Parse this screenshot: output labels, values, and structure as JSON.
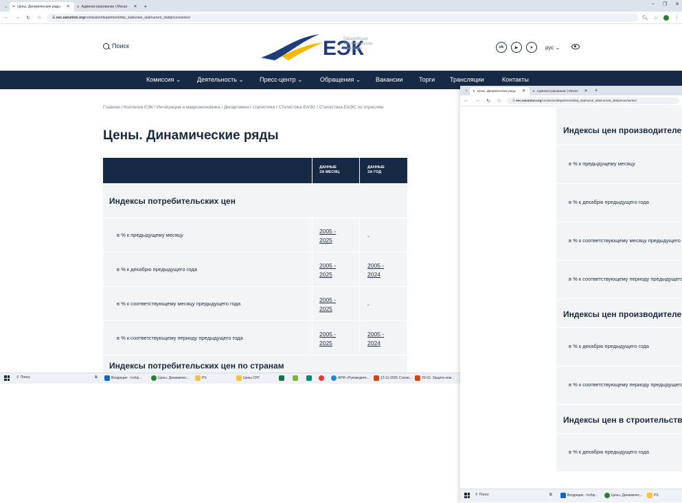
{
  "browser1": {
    "tabs": [
      {
        "label": "Цены. Динамические ряды"
      },
      {
        "label": "Администрирование | Мекал"
      }
    ],
    "new_tab": "+",
    "url_host": "eec.eaeunion.org",
    "url_path": "/comission/department/dep_stat/union_stat/current_stat/prices/series/"
  },
  "site": {
    "search_label": "Поиск",
    "logo_abbr": "ЕЭК",
    "logo_lines": [
      "Евразийская",
      "экономическая",
      "комиссия"
    ],
    "social": [
      "vk-icon",
      "youtube-icon",
      "telegram-icon"
    ],
    "lang_label": "рус",
    "nav": [
      {
        "label": "Комиссия ⌄"
      },
      {
        "label": "Деятельность ⌄"
      },
      {
        "label": "Пресс-центр ⌄"
      },
      {
        "label": "Обращения ⌄"
      },
      {
        "label": "Вакансии"
      },
      {
        "label": "Торги"
      },
      {
        "label": "Трансляции"
      },
      {
        "label": "Контакты"
      }
    ],
    "breadcrumb": "Главная / Коллегия ЕЭК / Интеграция и макроэкономика / Департамент статистики / Статистика ЕАЭС / Статистика ЕАЭС по отраслям",
    "page_title": "Цены. Динамические ряды",
    "table": {
      "col_month": "ДАННЫЕ ЗА МЕСЯЦ",
      "col_month_l1": "ДАННЫЕ",
      "col_month_l2": "ЗА МЕСЯЦ",
      "col_year_l1": "ДАННЫЕ",
      "col_year_l2": "ЗА ГОД",
      "section1": "Индексы потребительских цен",
      "rows": [
        {
          "label": "в % к предыдущему месяцу",
          "month_a": "2005 -",
          "month_b": "2025",
          "year_a": "-",
          "year_b": ""
        },
        {
          "label": "в % к декабрю предыдущего года",
          "month_a": "2005 -",
          "month_b": "2025",
          "year_a": "2005 -",
          "year_b": "2024"
        },
        {
          "label": "в % к соответствующему месяцу предыдущего года",
          "month_a": "2005 -",
          "month_b": "2025",
          "year_a": "-",
          "year_b": ""
        },
        {
          "label": "в % к соответствующему периоду предыдущего года",
          "month_a": "2005 -",
          "month_b": "2025",
          "year_a": "2005 -",
          "year_b": "2024"
        }
      ],
      "section2": "Индексы потребительских цен по странам"
    }
  },
  "taskbar1": {
    "search": "Поиск",
    "items": [
      "Входящие - Irzhip...",
      "Цены. Динамичес...",
      "PS",
      "Цены СНГ",
      "АРМ «Руководите...",
      "12-11-2025 Статис...",
      "20-02. Защита ком..."
    ]
  },
  "browser2": {
    "tabs": [
      {
        "label": "Цены. Динамические ряды"
      },
      {
        "label": "Администрирование | Мекал"
      }
    ],
    "url_host": "eec.eaeunion.org",
    "url_path": "/comission/department/dep_stat/union_stat/current_stat/prices/series/",
    "blocks": [
      {
        "kind": "section",
        "text": "Индексы цен производителей"
      },
      {
        "kind": "row",
        "text": "в % к предыдущему месяцу"
      },
      {
        "kind": "row",
        "text": "в % к декабрю предыдущего года"
      },
      {
        "kind": "row",
        "text": "в % к соответствующему месяцу предыдущего года"
      },
      {
        "kind": "row",
        "text": "в % к соответствующему периоду предыдущего года"
      },
      {
        "kind": "section",
        "text": "Индексы цен производителей"
      },
      {
        "kind": "row",
        "text": "в % к декабрю предыдущего года"
      },
      {
        "kind": "row",
        "text": "в % к соответствующему периоду предыдущего года"
      },
      {
        "kind": "section",
        "text": "Индексы цен в строительстве"
      },
      {
        "kind": "row",
        "text": "в % к декабрю предыдущего года"
      }
    ]
  },
  "taskbar2": {
    "search": "Поиск",
    "items": [
      "Входящие - Irzhip...",
      "Цены. Динамичес...",
      "PS"
    ]
  },
  "colors": {
    "navy": "#162a45",
    "row_bg": "#f2f4f6",
    "logo_blue": "#1f3d7a",
    "logo_accent": "#f5b800"
  }
}
